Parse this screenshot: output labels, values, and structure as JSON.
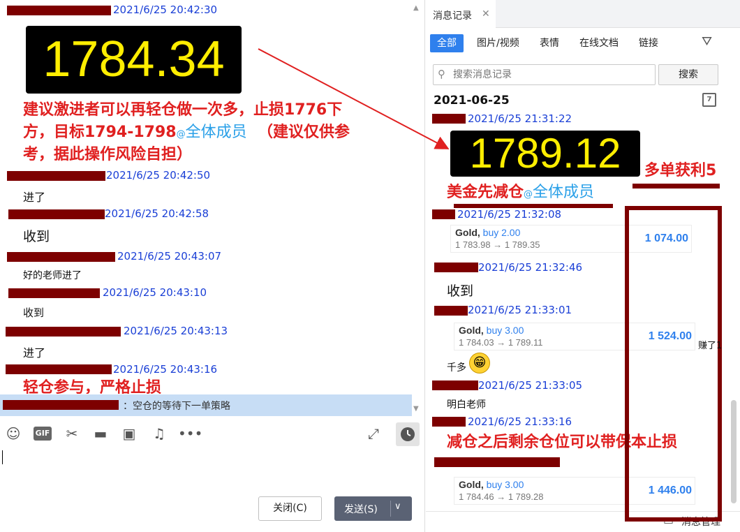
{
  "left": {
    "messages": [
      {
        "ts": "2021/6/25 20:42:30"
      },
      {
        "ts": "2021/6/25 20:42:50",
        "text": "进了"
      },
      {
        "ts": "2021/6/25 20:42:58",
        "text": "收到"
      },
      {
        "ts": "2021/6/25 20:43:07",
        "text": "好的老师进了"
      },
      {
        "ts": "2021/6/25 20:43:10",
        "text": "收到"
      },
      {
        "ts": "2021/6/25 20:43:13",
        "text": "进了"
      },
      {
        "ts": "2021/6/25 20:43:16"
      }
    ],
    "price_image": "1784.34",
    "advice_line1": "建议激进者可以再轻仓做一次多，止损1776下",
    "advice_line2_a": "方，目标1794-1798",
    "advice_at": "@",
    "advice_mention": "全体成员",
    "advice_line2_b": "（建议仅供参",
    "advice_line3": "考，据此操作风险自担）",
    "partial_text": "轻仓参与，严格止损",
    "reply_prefix": "：",
    "reply_text": "空仓的等待下一单策略"
  },
  "toolbar": {
    "gif_label": "GIF",
    "close_label": "关闭(C)",
    "send_label": "发送(S)"
  },
  "right": {
    "tab_title": "消息记录",
    "filter_tabs": [
      "全部",
      "图片/视频",
      "表情",
      "在线文档",
      "链接"
    ],
    "search_placeholder": "搜索消息记录",
    "search_btn": "搜索",
    "date_head": "2021-06-25",
    "cal_day": "7",
    "messages": [
      {
        "ts": "2021/6/25 21:31:22"
      },
      {
        "ts": "2021/6/25 21:32:08"
      },
      {
        "ts": "2021/6/25 21:32:46",
        "text": "收到"
      },
      {
        "ts": "2021/6/25 21:33:01"
      },
      {
        "ts": "2021/6/25 21:33:05",
        "text": "明白老师"
      },
      {
        "ts": "2021/6/25 21:33:16"
      }
    ],
    "price_image": "1789.12",
    "reduce_text": "美金先减仓",
    "reduce_at": "@",
    "reduce_mention": "全体成员",
    "qianduo": "千多",
    "trades": [
      {
        "sym": "Gold,",
        "side": "buy 2.00",
        "range": "1 783.98 → 1 789.35",
        "amount": "1 074.00"
      },
      {
        "sym": "Gold,",
        "side": "buy 3.00",
        "range": "1 784.03 → 1 789.11",
        "amount": "1 524.00"
      },
      {
        "sym": "Gold,",
        "side": "buy 3.00",
        "range": "1 784.46 → 1 789.28",
        "amount": "1 446.00"
      }
    ],
    "bottom_label": "消息管理"
  },
  "annotations": {
    "profit_text": "多单获利5",
    "earn_text": "赚了1",
    "after_reduce_text": "减仓之后剩余仓位可以带保本止损"
  },
  "colors": {
    "redact": "#7d0000",
    "annot_red": "#e02020",
    "timestamp_blue": "#1a3fd6",
    "mention_blue": "#2aa0e8",
    "price_yellow": "#ffee00",
    "accent": "#2f80ed"
  }
}
